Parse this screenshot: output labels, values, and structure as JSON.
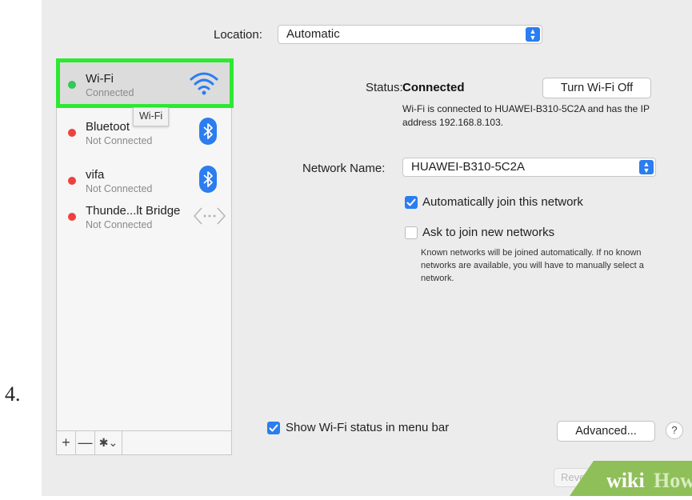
{
  "step": {
    "number": "4."
  },
  "location": {
    "label": "Location:",
    "value": "Automatic"
  },
  "sidebar": {
    "items": [
      {
        "name": "Wi-Fi",
        "status": "Connected",
        "status_color": "#34c759",
        "icon": "wifi-icon",
        "selected": true
      },
      {
        "name": "Bluetoot",
        "status": "Not Connected",
        "status_color": "#ef3f3f",
        "icon": "bluetooth-icon"
      },
      {
        "name": "vifa",
        "status": "Not Connected",
        "status_color": "#ef3f3f",
        "icon": "bluetooth-icon"
      },
      {
        "name": "Thunde...lt Bridge",
        "status": "Not Connected",
        "status_color": "#ef3f3f",
        "icon": "thunderbolt-bridge-icon"
      }
    ],
    "tooltip": "Wi-Fi",
    "toolbar": {
      "add": "+",
      "remove": "—",
      "gear": "✱⌄"
    }
  },
  "main": {
    "status_label": "Status:",
    "status_value": "Connected",
    "turn_off_button": "Turn Wi-Fi Off",
    "status_description": "Wi-Fi is connected to HUAWEI-B310-5C2A and has the IP address 192.168.8.103.",
    "network_name_label": "Network Name:",
    "network_name_value": "HUAWEI-B310-5C2A",
    "auto_join_label": "Automatically join this network",
    "auto_join_checked": true,
    "ask_join_label": "Ask to join new networks",
    "ask_join_checked": false,
    "ask_join_help": "Known networks will be joined automatically. If no known networks are available, you will have to manually select a network.",
    "show_status_label": "Show Wi-Fi status in menu bar",
    "show_status_checked": true,
    "advanced_button": "Advanced...",
    "help_button": "?",
    "revert_button": "Revert"
  },
  "watermark": {
    "text": "wikiHow",
    "wiki": "wiki",
    "how": "How"
  },
  "colors": {
    "highlight": "#2ee832",
    "accent": "#2b7df0"
  }
}
